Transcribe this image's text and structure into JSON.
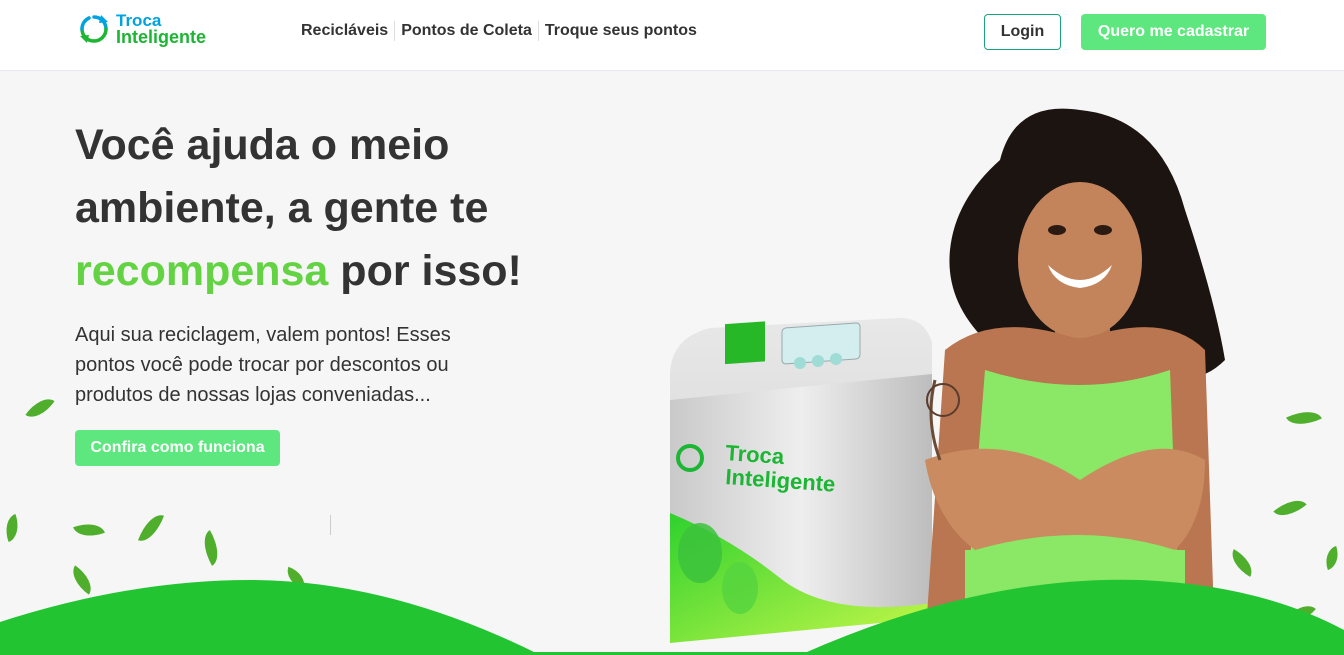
{
  "brand": {
    "line1": "Troca",
    "line2": "Inteligente"
  },
  "nav": {
    "items": [
      "Recicláveis",
      "Pontos de Coleta",
      "Troque seus pontos"
    ]
  },
  "header": {
    "login_label": "Login",
    "signup_label": "Quero me cadastrar"
  },
  "hero": {
    "title_part1": "Você ajuda o meio ambiente, a gente te",
    "title_accent": "recompensa",
    "title_part2": "por isso!",
    "text": "Aqui sua reciclagem, valem pontos! Esses pontos você pode trocar por descontos ou produtos de nossas lojas conveniadas...",
    "cta_label": "Confira como funciona"
  },
  "machine": {
    "brand_line1": "Troca",
    "brand_line2": "Inteligente"
  },
  "colors": {
    "accent_green": "#64d343",
    "button_green": "#5ee67f",
    "logo_blue": "#00a3e0",
    "hill_green": "#22c531"
  }
}
